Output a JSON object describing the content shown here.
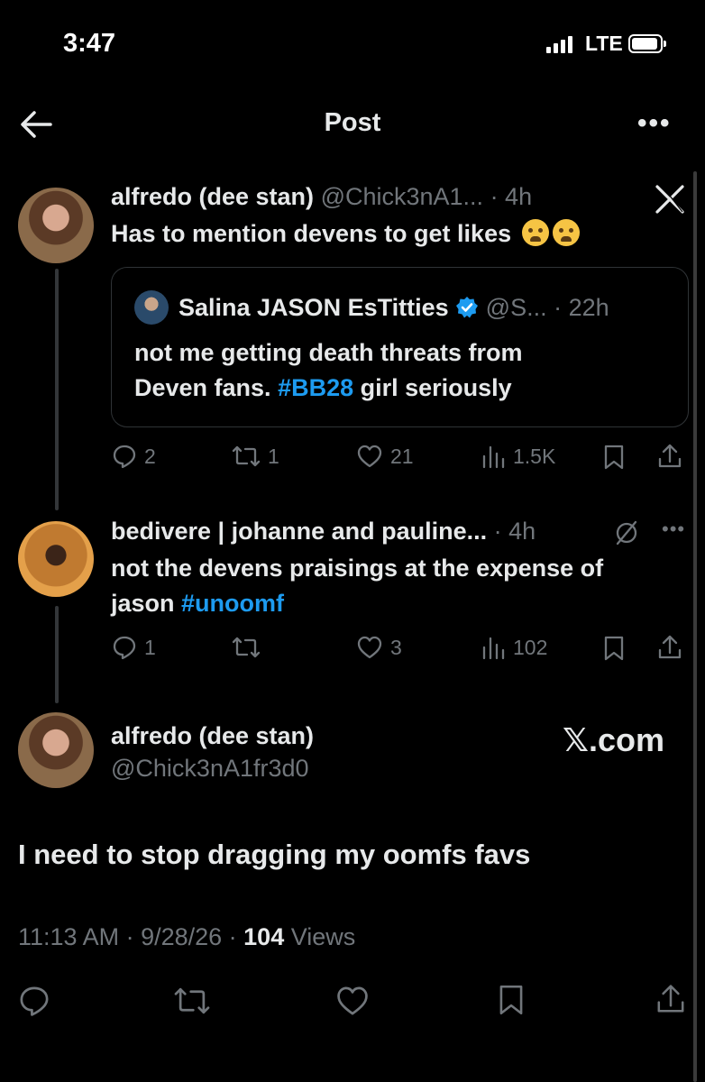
{
  "status_bar": {
    "time": "3:47",
    "network": "LTE"
  },
  "header": {
    "title": "Post",
    "more": "•••"
  },
  "reply1": {
    "name": "alfredo (dee stan)",
    "handle": "@Chick3nA1...",
    "time": "· 4h",
    "text": "Has to mention devens to get likes",
    "quote": {
      "name": "Salina JASON EsTitties",
      "handle": "@S...",
      "time": "· 22h",
      "line1": "not me getting death threats from",
      "line2_pre": "Deven fans. ",
      "hashtag": "#BB28",
      "line2_post": " girl seriously"
    },
    "actions": {
      "replies": "2",
      "reposts": "1",
      "likes": "21",
      "views": "1.5K"
    }
  },
  "reply2": {
    "name": "bedivere | johanne and pauline...",
    "time": "· 4h",
    "line1": "not the devens praisings at the expense of",
    "line2_pre": "jason ",
    "hashtag": "#unoomf",
    "actions": {
      "replies": "1",
      "reposts": "",
      "likes": "3",
      "views": "102"
    }
  },
  "main": {
    "name": "alfredo (dee stan)",
    "handle": "@Chick3nA1fr3d0",
    "source": "𝕏.com",
    "text": "I need to stop dragging my oomfs favs",
    "time": "11:13 AM · 9/28/26 · ",
    "views_count": "104",
    "views_label": " Views"
  },
  "icons": [
    "back-arrow-icon",
    "more-icon",
    "x-logo-icon",
    "verified-badge-icon",
    "reply-icon",
    "repost-icon",
    "like-icon",
    "views-icon",
    "bookmark-icon",
    "share-icon",
    "muted-icon"
  ],
  "colors": {
    "background": "#000000",
    "text": "#e7e9ea",
    "secondary": "#71767b",
    "link": "#1d9bf0"
  }
}
